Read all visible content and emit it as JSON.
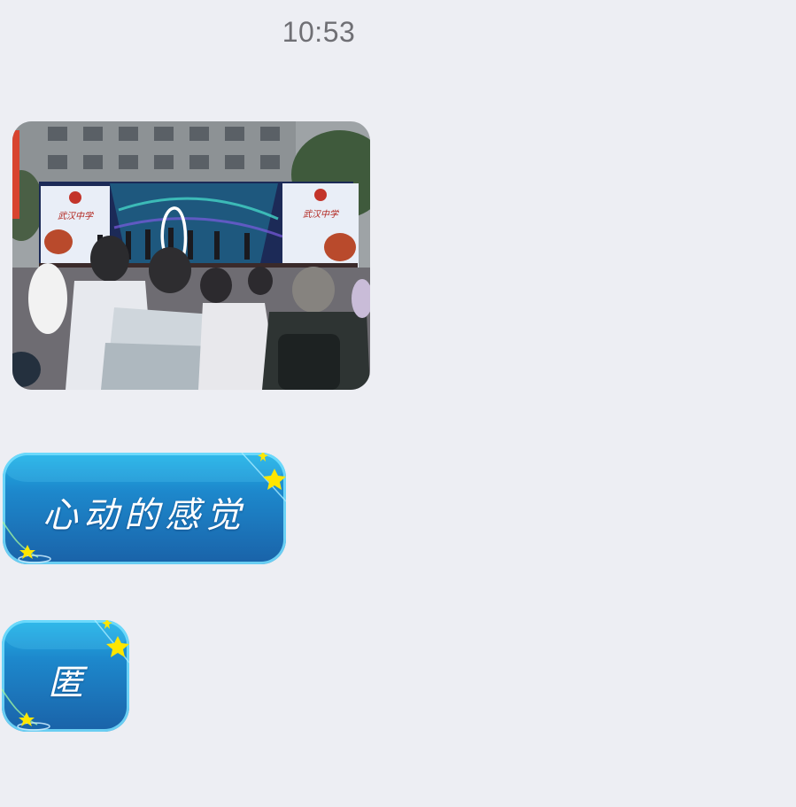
{
  "header": {
    "time": "10:53"
  },
  "messages": [
    {
      "type": "image",
      "content": "photo",
      "stage_banner_text": "武汉中学"
    },
    {
      "type": "text",
      "text": "心动的感觉"
    },
    {
      "type": "text",
      "text": "匿"
    }
  ],
  "colors": {
    "background": "#edeef3",
    "bubble_top": "#22b2e6",
    "bubble_bottom": "#1a62a8",
    "bubble_border": "#78e1ff",
    "star": "#ffe600"
  }
}
